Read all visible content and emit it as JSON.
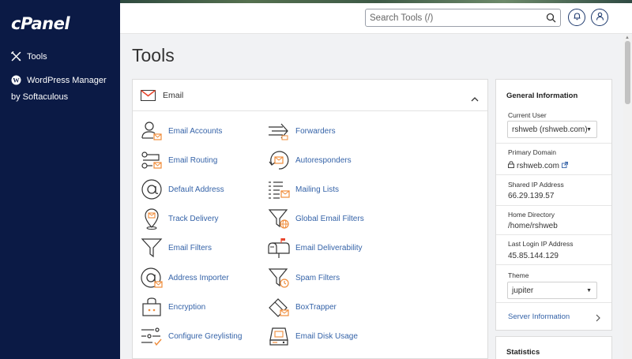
{
  "sidebar": {
    "logo": "cPanel",
    "items": [
      {
        "label": "Tools",
        "icon": "tools-icon"
      },
      {
        "label": "WordPress Manager",
        "icon": "wordpress-icon"
      }
    ],
    "wp_sub": "by Softaculous"
  },
  "header": {
    "search_placeholder": "Search Tools (/)"
  },
  "page_title": "Tools",
  "email_panel": {
    "title": "Email",
    "tools": [
      {
        "label": "Email Accounts",
        "icon": "email-accounts-icon"
      },
      {
        "label": "Forwarders",
        "icon": "forwarders-icon"
      },
      {
        "label": "Email Routing",
        "icon": "email-routing-icon"
      },
      {
        "label": "Autoresponders",
        "icon": "autoresponders-icon"
      },
      {
        "label": "Default Address",
        "icon": "at-sign-icon"
      },
      {
        "label": "Mailing Lists",
        "icon": "mailing-list-icon"
      },
      {
        "label": "Track Delivery",
        "icon": "location-pin-icon"
      },
      {
        "label": "Global Email Filters",
        "icon": "global-filter-icon"
      },
      {
        "label": "Email Filters",
        "icon": "funnel-icon"
      },
      {
        "label": "Email Deliverability",
        "icon": "mailbox-icon"
      },
      {
        "label": "Address Importer",
        "icon": "address-importer-icon"
      },
      {
        "label": "Spam Filters",
        "icon": "spam-filter-icon"
      },
      {
        "label": "Encryption",
        "icon": "encryption-icon"
      },
      {
        "label": "BoxTrapper",
        "icon": "boxtrapper-icon"
      },
      {
        "label": "Configure Greylisting",
        "icon": "greylisting-icon"
      },
      {
        "label": "Email Disk Usage",
        "icon": "disk-usage-icon"
      }
    ]
  },
  "general_info": {
    "title": "General Information",
    "current_user_label": "Current User",
    "current_user_value": "rshweb (rshweb.com)",
    "primary_domain_label": "Primary Domain",
    "primary_domain_value": "rshweb.com",
    "shared_ip_label": "Shared IP Address",
    "shared_ip_value": "66.29.139.57",
    "home_dir_label": "Home Directory",
    "home_dir_value": "/home/rshweb",
    "last_login_label": "Last Login IP Address",
    "last_login_value": "45.85.144.129",
    "theme_label": "Theme",
    "theme_value": "jupiter",
    "server_info_link": "Server Information"
  },
  "statistics": {
    "title": "Statistics"
  },
  "colors": {
    "sidebar_bg": "#0b1a45",
    "link": "#3563a8",
    "accent_orange": "#f08c3a"
  }
}
